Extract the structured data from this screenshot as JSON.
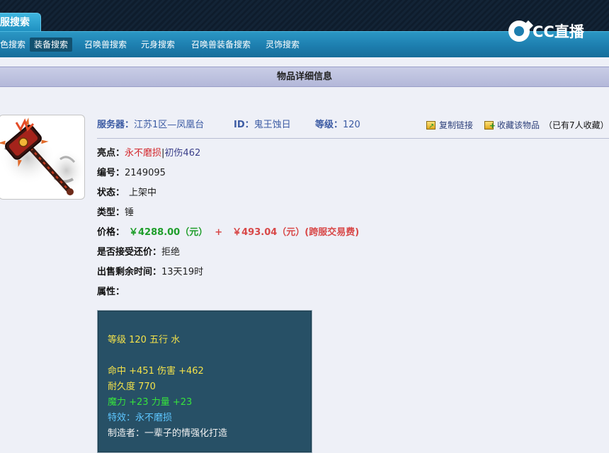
{
  "header": {
    "tab_label": "服搜索",
    "nav": [
      "色搜索",
      "装备搜索",
      "召唤兽搜索",
      "元身搜索",
      "召唤兽装备搜索",
      "灵饰搜索"
    ],
    "active_nav": "装备搜索",
    "logo_text": "CC直播",
    "colors": {
      "nav": "#1d7eaf",
      "band": "#132436"
    }
  },
  "section": {
    "title": "物品详细信息"
  },
  "item": {
    "image_icon": "hammer-weapon-icon",
    "server_label": "服务器：",
    "server_value": "江苏1区—凤凰台",
    "id_label": "ID：",
    "id_value": "鬼王蚀日",
    "level_label": "等级：",
    "level_value": "120",
    "copy_link": "复制链接",
    "collect": "收藏该物品",
    "collect_count": "（已有7人收藏）",
    "highlight_label": "亮点：",
    "highlight_red": "永不磨损",
    "highlight_sep": "|",
    "highlight_extra": "初伤462",
    "code_label": "编号：",
    "code_value": "2149095",
    "status_label": "状态：",
    "status_value": "上架中",
    "type_label": "类型：",
    "type_value": "锤",
    "price_label": "价格：",
    "price_main": "￥4288.00（元）",
    "price_plus": "+",
    "price_fee": "￥493.04（元）(跨服交易费)",
    "bargain_label": "是否接受还价：",
    "bargain_value": "拒绝",
    "time_label": "出售剩余时间：",
    "time_value": "13天19时",
    "attr_label": "属性："
  },
  "attributes": {
    "level_line": "等级 120  五行 水",
    "line1": "命中 +451 伤害 +462",
    "line2": "耐久度 770",
    "line3": "魔力 +23 力量 +23",
    "line4": "特效：永不磨损",
    "line5": "制造者：一辈子的情强化打造"
  }
}
